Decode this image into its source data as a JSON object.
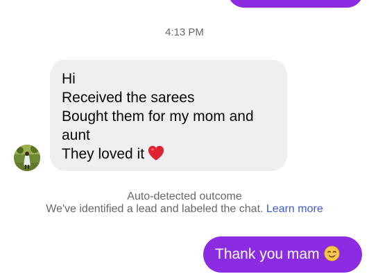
{
  "chat": {
    "timestamp": "4:13 PM",
    "incoming_message": {
      "lines": [
        "Hi",
        "Received the sarees",
        "Bought them for my mom and",
        "aunt",
        "They loved it"
      ],
      "emoji": "heart-icon"
    },
    "outcome": {
      "title": "Auto-detected outcome",
      "description": "We've identified a lead and labeled the chat.",
      "link_label": "Learn more"
    },
    "outgoing_message": {
      "text": "Thank you mam",
      "emoji": "smiling-face-icon"
    }
  },
  "colors": {
    "outgoing_bubble": "#8b2be2",
    "incoming_bubble": "#efefef",
    "link": "#3b5bdb",
    "muted_text": "#65676b"
  }
}
